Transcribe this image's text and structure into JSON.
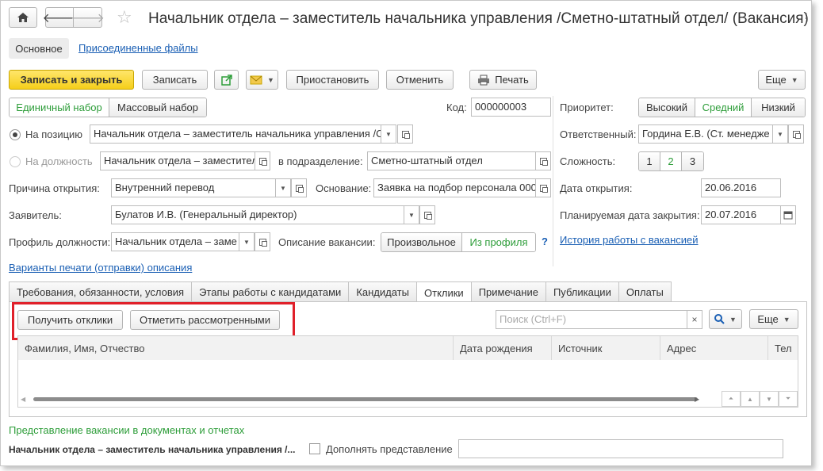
{
  "header": {
    "title": "Начальник отдела – заместитель начальника управления /Сметно-штатный отдел/ (Вакансия)",
    "more_glyph": "⋮",
    "close_glyph": "×"
  },
  "nav_tabs": [
    "Основное",
    "Присоединенные файлы"
  ],
  "toolbar": {
    "save_close": "Записать и закрыть",
    "save": "Записать",
    "suspend": "Приостановить",
    "cancel": "Отменить",
    "print": "Печать",
    "more": "Еще"
  },
  "selection_mode": {
    "options": [
      "Единичный набор",
      "Массовый набор"
    ],
    "selected": "Единичный набор"
  },
  "code": {
    "label": "Код:",
    "value": "000000003"
  },
  "position": {
    "label": "На позицию",
    "value": "Начальник отдела – заместитель начальника управления /С"
  },
  "post": {
    "label": "На должность",
    "value": "Начальник отдела – заместител",
    "subdivision_label": "в подразделение:",
    "subdivision_value": "Сметно-штатный отдел"
  },
  "reason": {
    "label": "Причина открытия:",
    "value": "Внутренний перевод",
    "basis_label": "Основание:",
    "basis_value": "Заявка на подбор персонала 000"
  },
  "applicant": {
    "label": "Заявитель:",
    "value": "Булатов И.В. (Генеральный директор)"
  },
  "profile": {
    "label": "Профиль должности:",
    "value": "Начальник отдела – заме",
    "desc_label": "Описание вакансии:",
    "desc_options": [
      "Произвольное",
      "Из профиля"
    ],
    "desc_selected": "Из профиля",
    "help": "?"
  },
  "print_variants_link": "Варианты печати (отправки) описания",
  "priority": {
    "label": "Приоритет:",
    "options": [
      "Высокий",
      "Средний",
      "Низкий"
    ],
    "selected": "Средний"
  },
  "responsible": {
    "label": "Ответственный:",
    "value": "Гордина Е.В. (Ст. менедже"
  },
  "complexity": {
    "label": "Сложность:",
    "options": [
      "1",
      "2",
      "3"
    ],
    "selected": "2"
  },
  "open_date": {
    "label": "Дата открытия:",
    "value": "20.06.2016"
  },
  "planned_close": {
    "label": "Планируемая дата закрытия:",
    "value": "20.07.2016"
  },
  "history_link": "История работы с вакансией",
  "tabs": [
    "Требования, обязанности, условия",
    "Этапы работы с кандидатами",
    "Кандидаты",
    "Отклики",
    "Примечание",
    "Публикации",
    "Оплаты"
  ],
  "active_tab": "Отклики",
  "responses": {
    "get_btn": "Получить отклики",
    "mark_btn": "Отметить рассмотренными",
    "search_placeholder": "Поиск (Ctrl+F)",
    "more": "Еще",
    "columns": [
      "Фамилия, Имя, Отчество",
      "Дата рождения",
      "Источник",
      "Адрес",
      "Тел"
    ]
  },
  "presentation": {
    "heading": "Представление вакансии в документах и отчетах",
    "value": "Начальник отдела – заместитель начальника управления /...",
    "checkbox_label": "Дополнять представление"
  },
  "colors": {
    "accent_green": "#2d9d39",
    "highlight_red": "#e0202a",
    "primary_yellow": "#f5cf1a",
    "link_blue": "#1a5fb4"
  }
}
